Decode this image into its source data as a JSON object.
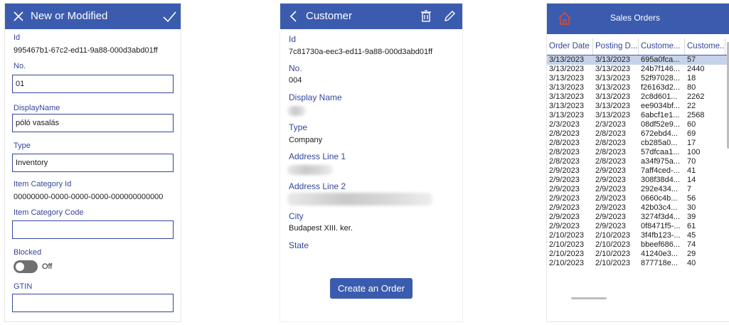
{
  "colors": {
    "header": "#3b5cae",
    "label": "#34469a",
    "selected_row": "#c5d3ea",
    "home_icon": "#e04a2c"
  },
  "panel1": {
    "header_title": "New or Modified",
    "close_icon": "close-icon",
    "check_icon": "check-icon",
    "id_label": "Id",
    "id_value": "995467b1-67c2-ed11-9a88-000d3abd01ff",
    "no_label": "No.",
    "no_value": "01",
    "display_name_label": "DisplayName",
    "display_name_value": "póló vasalás",
    "type_label": "Type",
    "type_value": "Inventory",
    "item_category_id_label": "Item Category Id",
    "item_category_id_value": "00000000-0000-0000-0000-000000000000",
    "item_category_code_label": "Item Category Code",
    "item_category_code_value": "",
    "blocked_label": "Blocked",
    "blocked_state": "Off",
    "gtin_label": "GTIN",
    "gtin_value": ""
  },
  "panel2": {
    "header_title": "Customer",
    "id_label": "Id",
    "id_value": "7c81730a-eec3-ed11-9a88-000d3abd01ff",
    "no_label": "No.",
    "no_value": "004",
    "display_name_label": "Display Name",
    "type_label": "Type",
    "type_value": "Company",
    "address1_label": "Address Line 1",
    "address2_label": "Address Line 2",
    "city_label": "City",
    "city_value": "Budapest XIII. ker.",
    "state_label": "State",
    "create_button": "Create an Order"
  },
  "panel3": {
    "header_title": "Sales Orders",
    "columns": [
      "Order Date",
      "Posting D...",
      "Custome...",
      "Custome..."
    ],
    "rows": [
      [
        "3/13/2023",
        "3/13/2023",
        "695a0fca...",
        "57"
      ],
      [
        "3/13/2023",
        "3/13/2023",
        "24b7f146...",
        "2440"
      ],
      [
        "3/13/2023",
        "3/13/2023",
        "52f97028...",
        "18"
      ],
      [
        "3/13/2023",
        "3/13/2023",
        "f26163d2...",
        "80"
      ],
      [
        "3/13/2023",
        "3/13/2023",
        "2c8d601...",
        "2262"
      ],
      [
        "3/13/2023",
        "3/13/2023",
        "ee9034bf...",
        "22"
      ],
      [
        "3/13/2023",
        "3/13/2023",
        "6abcf1e1...",
        "2568"
      ],
      [
        "2/3/2023",
        "2/3/2023",
        "08df52e9...",
        "60"
      ],
      [
        "2/8/2023",
        "2/8/2023",
        "672ebd4...",
        "69"
      ],
      [
        "2/8/2023",
        "2/8/2023",
        "cb285a0...",
        "17"
      ],
      [
        "2/8/2023",
        "2/8/2023",
        "57dfcaa1...",
        "100"
      ],
      [
        "2/8/2023",
        "2/8/2023",
        "a34f975a...",
        "70"
      ],
      [
        "2/9/2023",
        "2/9/2023",
        "7aff4ced-...",
        "41"
      ],
      [
        "2/9/2023",
        "2/9/2023",
        "308f38d4...",
        "14"
      ],
      [
        "2/9/2023",
        "2/9/2023",
        "292e434...",
        "7"
      ],
      [
        "2/9/2023",
        "2/9/2023",
        "0660c4b...",
        "56"
      ],
      [
        "2/9/2023",
        "2/9/2023",
        "42b03c4...",
        "30"
      ],
      [
        "2/9/2023",
        "2/9/2023",
        "3274f3d4...",
        "39"
      ],
      [
        "2/9/2023",
        "2/9/2023",
        "0f8471f5-...",
        "61"
      ],
      [
        "2/10/2023",
        "2/10/2023",
        "3f4fb123-...",
        "45"
      ],
      [
        "2/10/2023",
        "2/10/2023",
        "bbeef686...",
        "74"
      ],
      [
        "2/10/2023",
        "2/10/2023",
        "41240e3...",
        "29"
      ],
      [
        "2/10/2023",
        "2/10/2023",
        "877718e...",
        "40"
      ]
    ]
  }
}
